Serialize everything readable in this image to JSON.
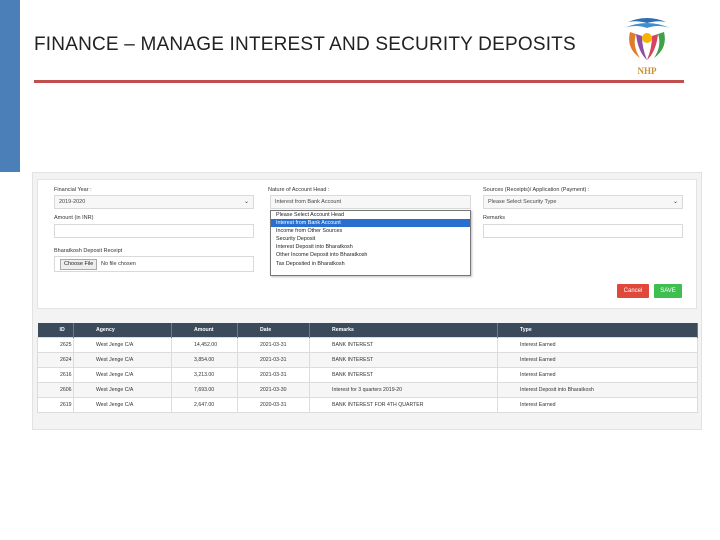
{
  "slide": {
    "title": "FINANCE – MANAGE INTEREST AND SECURITY DEPOSITS",
    "logo_text": "NHP",
    "colors": {
      "left_accent": "#4a7fb8",
      "title_rule": "#c0504d",
      "table_header": "#3b4b5c",
      "cancel": "#e0483b",
      "save": "#3fbf4f",
      "selected_option": "#2a6fcf"
    }
  },
  "form": {
    "financial_year": {
      "label": "Financial Year :",
      "value": "2019-2020"
    },
    "nature_of_account": {
      "label": "Nature of Account Head :",
      "value": "Interest from Bank Account"
    },
    "sources": {
      "label": "Sources (Receipts)/ Application (Payment) :",
      "value": "Please Select Security Type"
    },
    "amount": {
      "label": "Amount (in INR)",
      "value": ""
    },
    "remarks": {
      "label": "Remarks",
      "value": ""
    },
    "bharatkosh": {
      "label": "Bharatkosh Deposit Receipt",
      "button_label": "Choose File",
      "status": "No file chosen"
    },
    "dropdown_options": [
      "Please Select Account Head",
      "Interest from Bank Account",
      "Income from Other Sources",
      "Security Deposit",
      "Interest Deposit into Bharatkosh",
      "Other Income Deposit into Bharatkosh",
      "Tax Deposited in Bharatkosh"
    ],
    "dropdown_selected_index": 1,
    "cancel_label": "Cancel",
    "save_label": "SAVE"
  },
  "table": {
    "columns": [
      "ID",
      "Agency",
      "Amount",
      "Date",
      "Remarks",
      "Type"
    ],
    "rows": [
      [
        "2625",
        "West Jenge  C/A",
        "14,452.00",
        "2021-03-31",
        "BANK INTEREST",
        "Interest Earned"
      ],
      [
        "2624",
        "West Jenge  C/A",
        "3,854.00",
        "2021-03-31",
        "BANK INTEREST",
        "Interest Earned"
      ],
      [
        "2616",
        "West Jenge  C/A",
        "3,213.00",
        "2021-03-31",
        "BANK INTEREST",
        "Interest Earned"
      ],
      [
        "2606",
        "West Jenge  C/A",
        "7,693.00",
        "2021-03-30",
        "Interest for 3 quarters 2019-20",
        "Interest Deposit into Bharatkosh"
      ],
      [
        "2619",
        "West Jenge  C/A",
        "2,647.00",
        "2020-03-31",
        "BANK INTEREST FOR 4TH QUARTER",
        "Interest Earned"
      ]
    ]
  }
}
